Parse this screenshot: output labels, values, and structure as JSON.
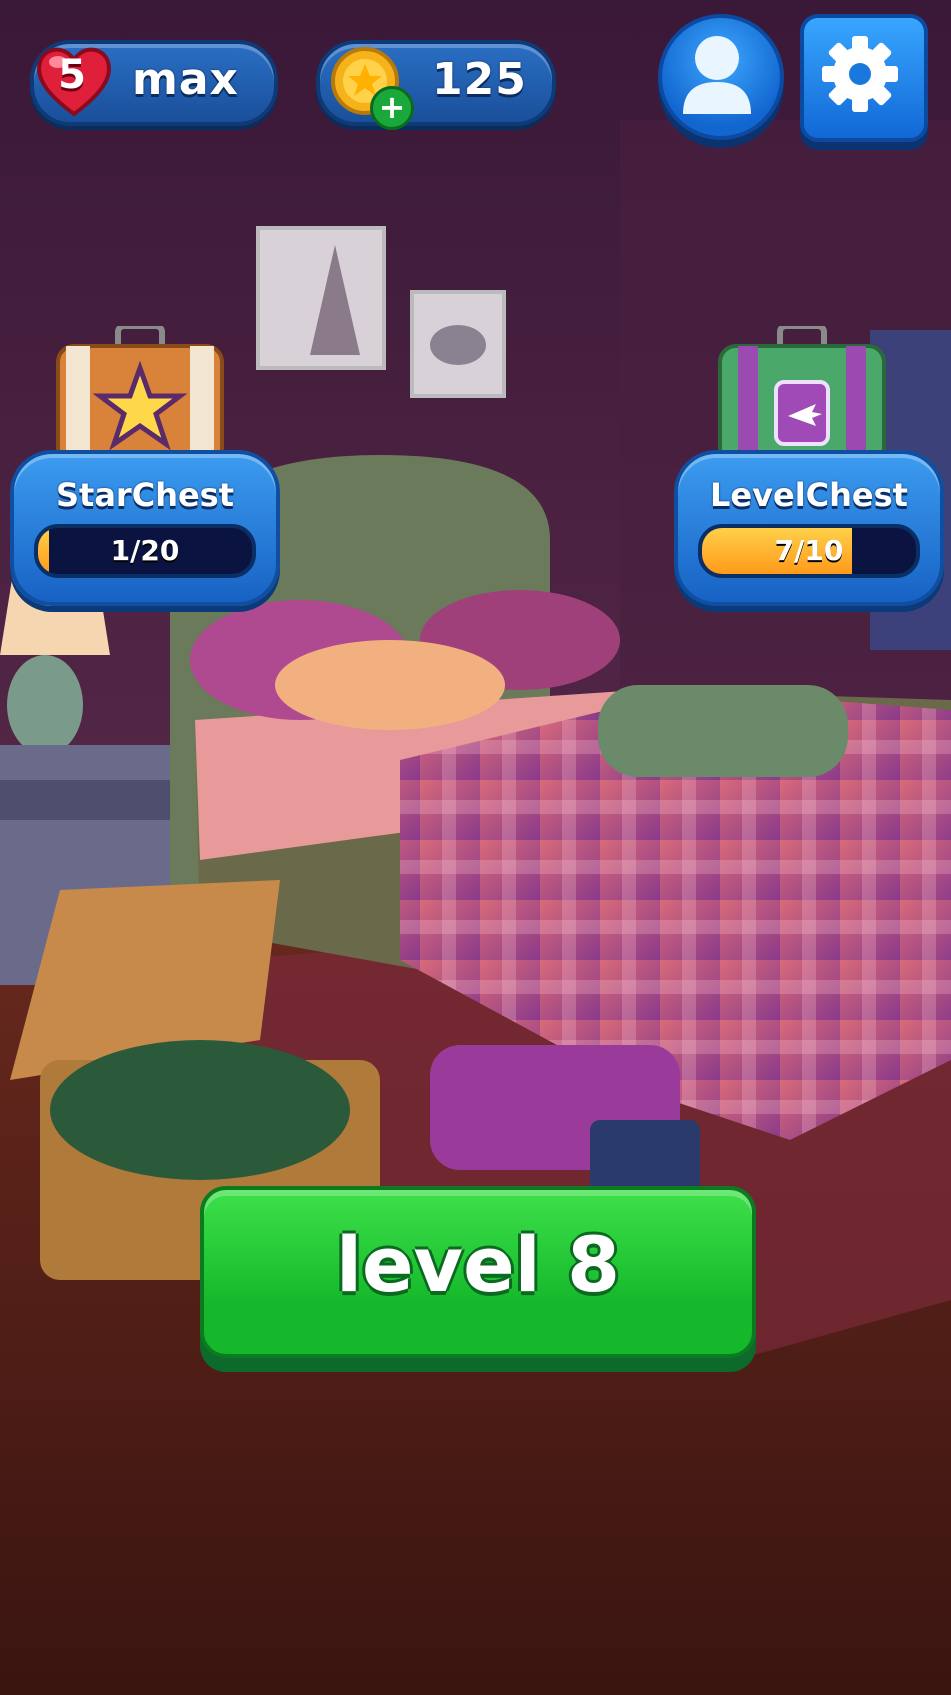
{
  "hud": {
    "lives_count": "5",
    "lives_label": "max",
    "coins": "125"
  },
  "chests": {
    "star": {
      "title": "StarChest",
      "progress_text": "1/20",
      "progress": 0.05
    },
    "level": {
      "title": "LevelChest",
      "progress_text": "7/10",
      "progress": 0.7
    }
  },
  "play": {
    "label": "level 8"
  },
  "icons": {
    "heart": "heart-icon",
    "coin": "coin-icon",
    "plus": "plus-icon",
    "profile": "profile-icon",
    "settings": "gear-icon"
  },
  "colors": {
    "hud_blue": "#1a4f9a",
    "play_green": "#14b82a",
    "bar_fill": "#ffb02a",
    "heart_red": "#e0203a"
  }
}
